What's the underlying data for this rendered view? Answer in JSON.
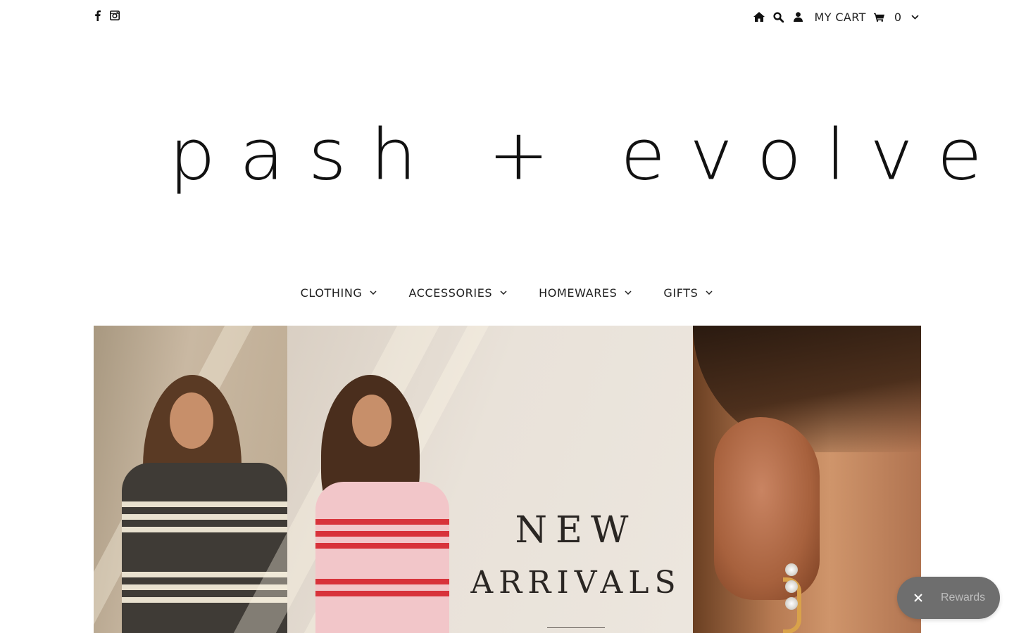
{
  "topbar": {
    "social": [
      {
        "name": "facebook-icon"
      },
      {
        "name": "instagram-icon"
      }
    ],
    "utility": {
      "cart_label": "MY CART",
      "cart_count": "0"
    }
  },
  "logo": {
    "text": "pash + evolve"
  },
  "nav": {
    "items": [
      {
        "label": "CLOTHING"
      },
      {
        "label": "ACCESSORIES"
      },
      {
        "label": "HOMEWARES"
      },
      {
        "label": "GIFTS"
      }
    ]
  },
  "hero": {
    "headline_1": "NEW",
    "headline_2": "ARRIVALS"
  },
  "rewards": {
    "label": "Rewards"
  },
  "colors": {
    "rewards_bg": "#6e6e6e",
    "text": "#1a1a1a"
  }
}
